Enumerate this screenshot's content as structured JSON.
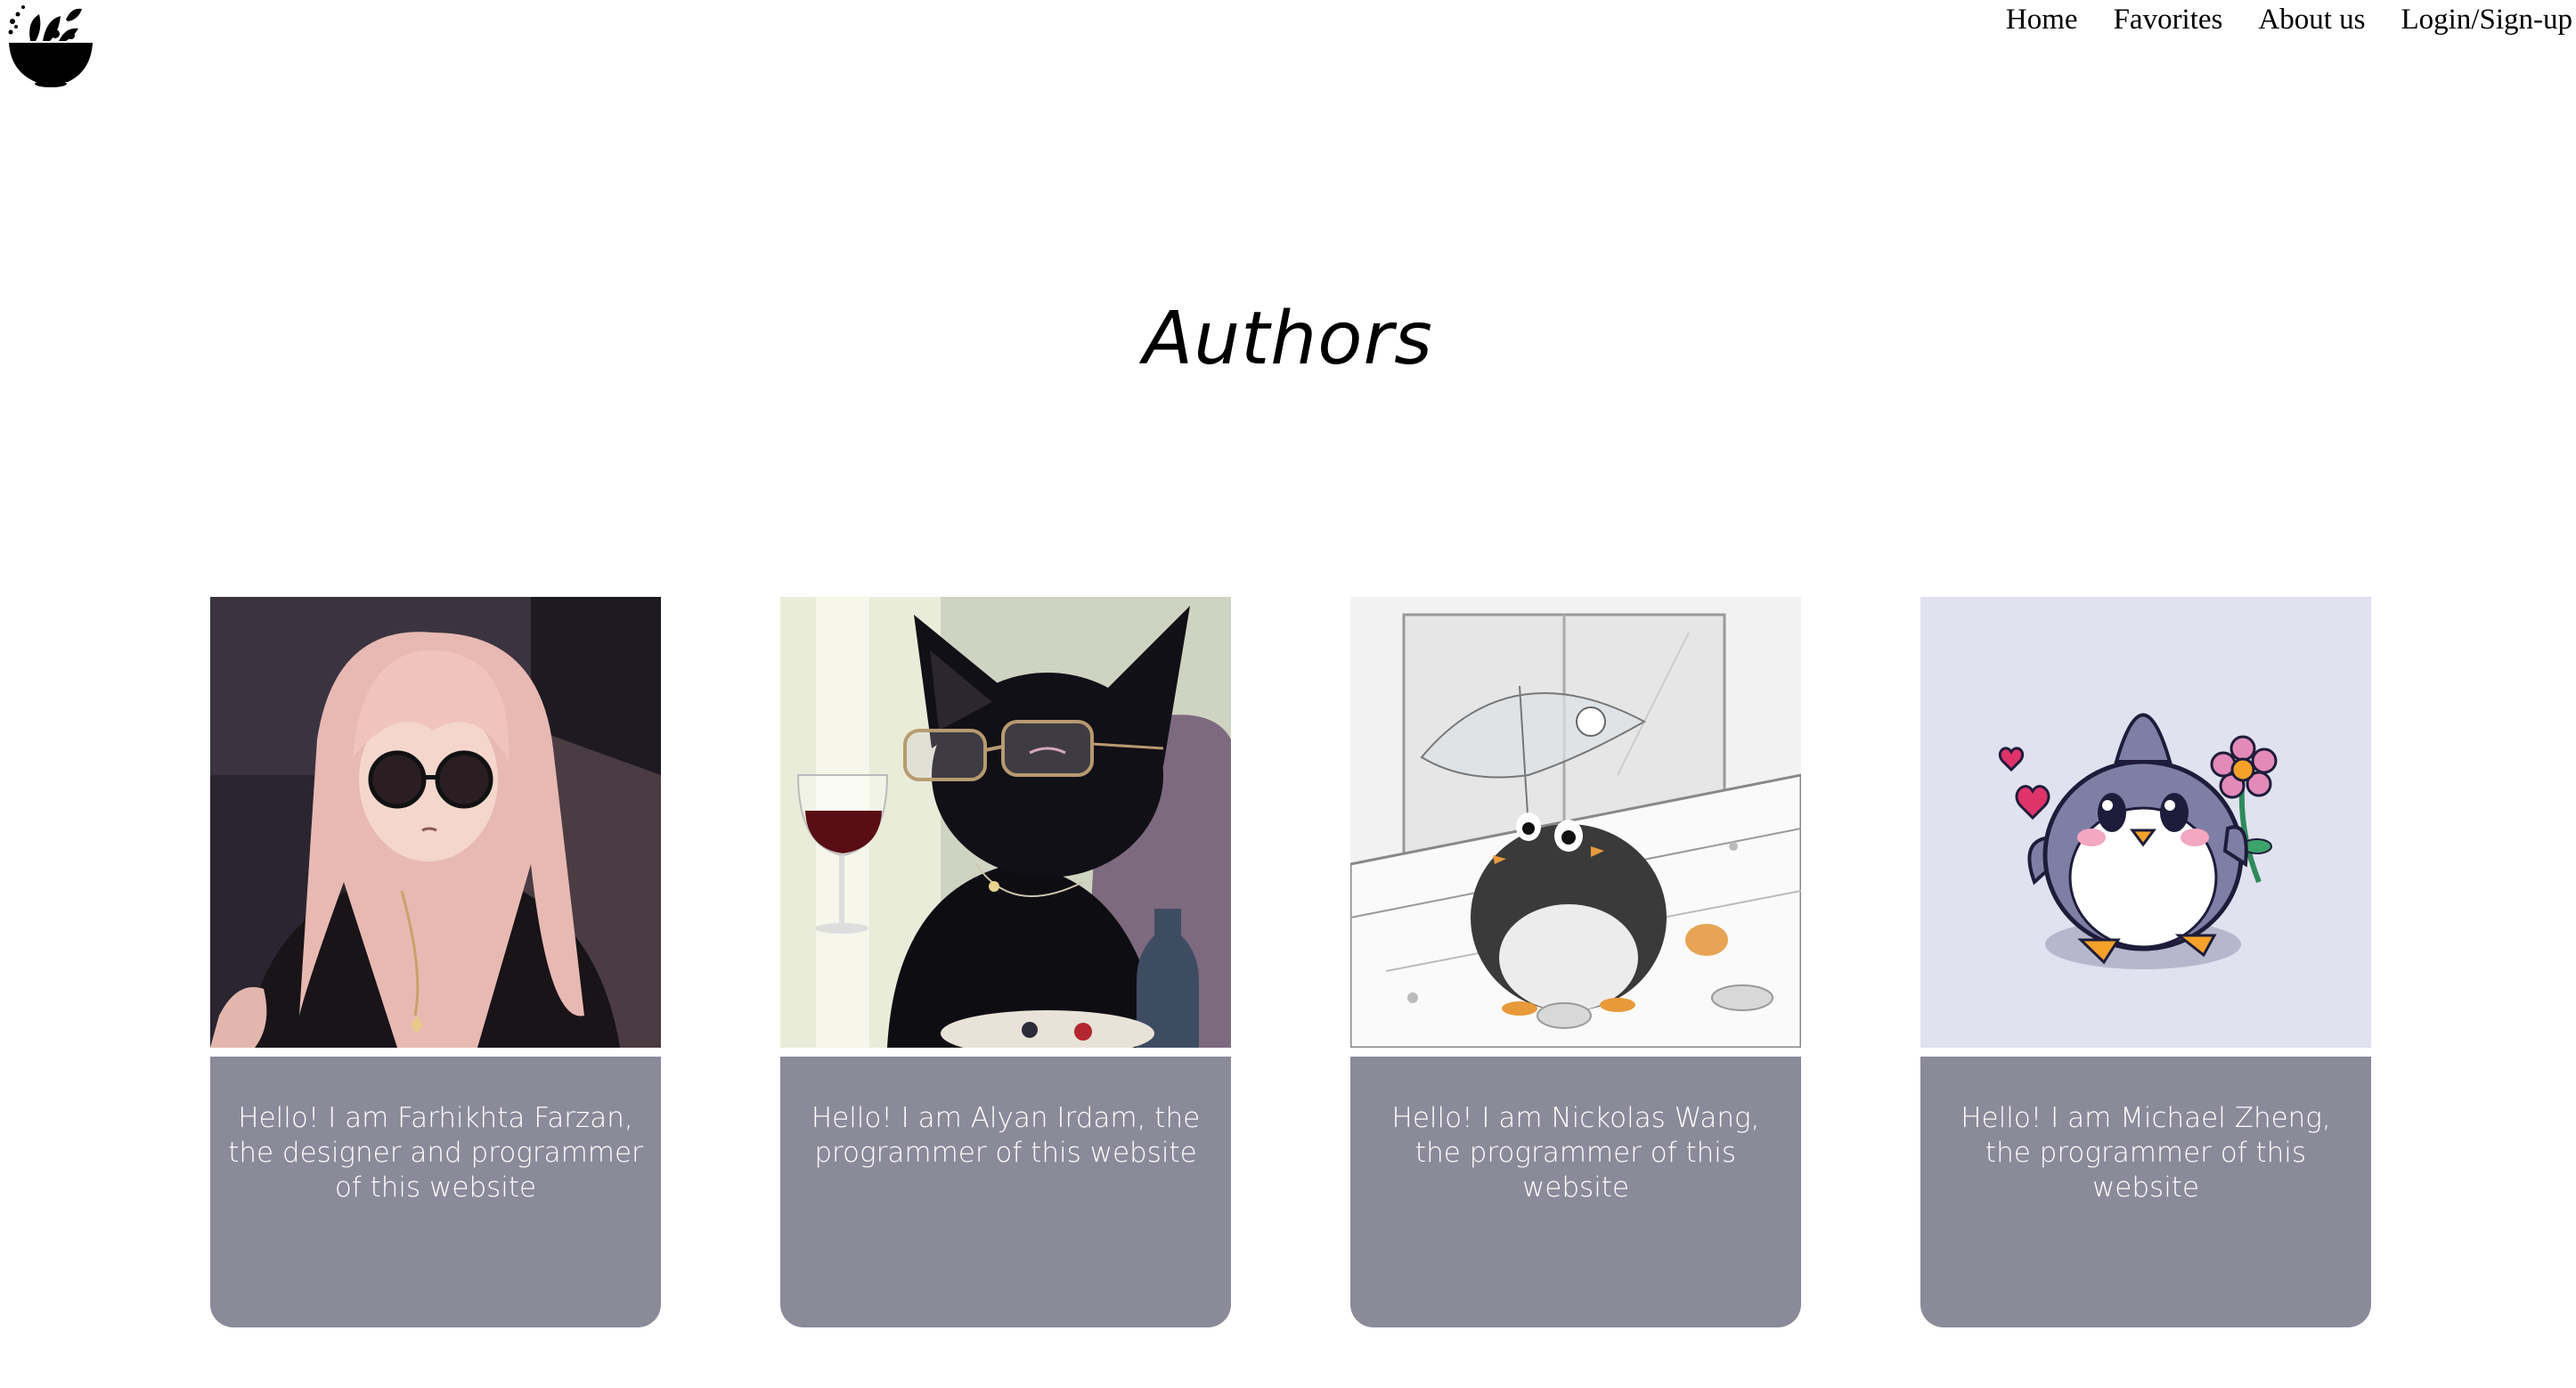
{
  "header": {
    "logo_icon": "salad-bowl-logo-icon",
    "nav": [
      {
        "label": "Home"
      },
      {
        "label": "Favorites"
      },
      {
        "label": "About us"
      },
      {
        "label": "Login/Sign-up"
      }
    ]
  },
  "main": {
    "title": "Authors",
    "authors": [
      {
        "bio": "Hello! I am Farhikhta Farzan, the designer and programmer of this website",
        "image_icon": "anime-girl-sunglasses-avatar"
      },
      {
        "bio": "Hello! I am Alyan Irdam, the programmer of this website",
        "image_icon": "black-cat-wine-glasses-avatar"
      },
      {
        "bio": "Hello! I am Nickolas Wang, the programmer of this website",
        "image_icon": "penguin-umbrella-sketch-avatar"
      },
      {
        "bio": "Hello! I am Michael Zheng, the programmer of this website",
        "image_icon": "cute-penguin-flower-avatar"
      }
    ]
  },
  "colors": {
    "card_body": "#8b8a99",
    "card_text": "#ffffff",
    "background": "#ffffff"
  }
}
